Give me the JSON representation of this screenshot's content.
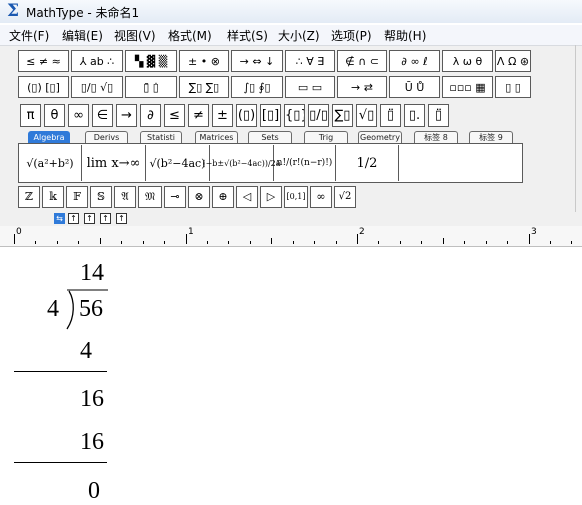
{
  "window": {
    "title": "MathType - 未命名1",
    "icon": "sigma-icon"
  },
  "menu": [
    "文件(F)",
    "编辑(E)",
    "视图(V)",
    "格式(M)",
    "样式(S)",
    "大小(Z)",
    "选项(P)",
    "帮助(H)"
  ],
  "palette": {
    "row1": [
      "≤ ≠ ≈",
      "⅄ ab ∴",
      "▚ ▓ ▒",
      "± • ⊗",
      "→ ⇔ ↓",
      "∴ ∀ ∃",
      "∉ ∩ ⊂",
      "∂ ∞ ℓ",
      "λ ω θ",
      "Λ Ω ⊛"
    ],
    "row2": [
      "(▯) [▯]",
      "▯/▯ √▯",
      "▯̄ ▯̇",
      "∑▯ ∑▯",
      "∫▯ ∮▯",
      "▭ ▭",
      "→ ⇄",
      "Ū Ů",
      "▫▫▫ ▦",
      "▯ ▯"
    ],
    "symbols": [
      "π",
      "θ",
      "∞",
      "∈",
      "→",
      "∂",
      "≤",
      "≠",
      "±",
      "(▯)",
      "[▯]",
      "{▯}",
      "▯/▯",
      "∑▯",
      "√▯",
      "▯̈",
      "▯.",
      "▯̈"
    ],
    "tabs": [
      "Algebra",
      "Derivs",
      "Statisti",
      "Matrices",
      "Sets",
      "Trig",
      "Geometry",
      "标签 8",
      "标签 9"
    ],
    "templates": [
      "√(a²+b²)",
      "lim x→∞",
      "√(b²−4ac)",
      "(−b±√(b²−4ac))/2a",
      "n!/(r!(n−r)!)",
      "1/2"
    ],
    "bottom": [
      "ℤ",
      "𝕜",
      "𝔽",
      "𝕊",
      "𝔄",
      "𝔐",
      "⊸",
      "⊗",
      "⊕",
      "◁",
      "▷",
      "[0,1]",
      "∞",
      "√2"
    ],
    "tab_stops": [
      "⇆",
      "↑",
      "↑",
      "↑",
      "↑"
    ]
  },
  "ruler": {
    "labels": [
      "0",
      "1",
      "2",
      "3"
    ]
  },
  "document": {
    "quotient": "14",
    "divisor": "4",
    "dividend": "56",
    "step1": "4",
    "remainder1": "16",
    "step2": "16",
    "remainder2": "0"
  }
}
